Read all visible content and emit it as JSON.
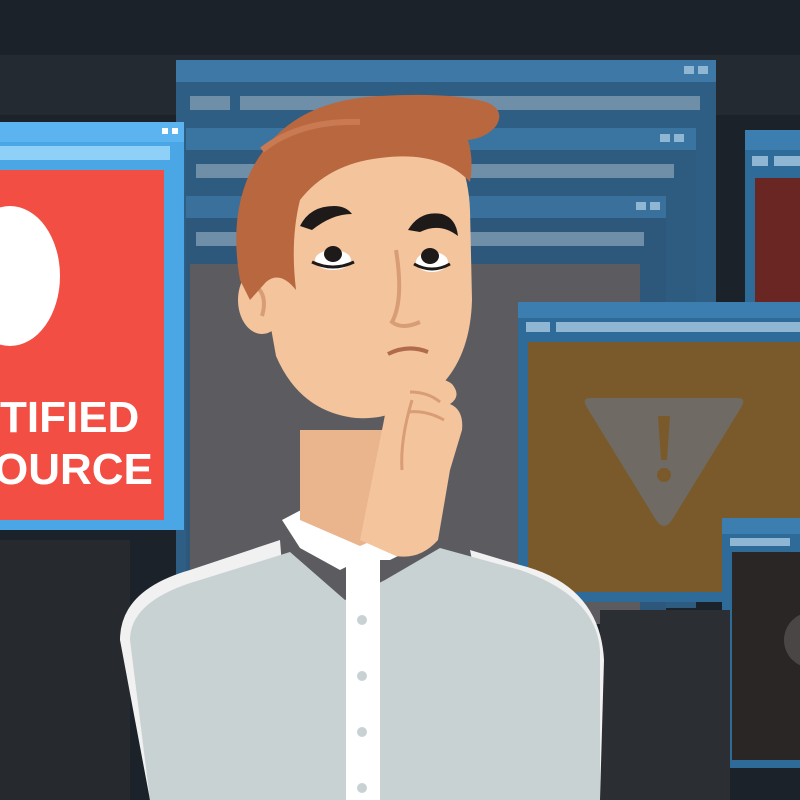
{
  "red_window": {
    "line1": "TIFIED",
    "line2": "OURCE"
  },
  "colors": {
    "background": "#1c2229",
    "window_frame": "#2f6b99",
    "window_frame_light": "#4aa6e4",
    "red_panel": "#f24e43",
    "warning_panel": "#7a5a2a",
    "warning_icon": "#6f6a63",
    "dark_panel": "#2a2626",
    "maroon_panel": "#6a2622",
    "hair": "#b8673f",
    "skin": "#f4c49c",
    "vest": "#c9d2d3",
    "shirt": "#ffffff"
  },
  "icons": {
    "warning": "warning-triangle-icon",
    "chat": "chat-bubble-icon"
  }
}
